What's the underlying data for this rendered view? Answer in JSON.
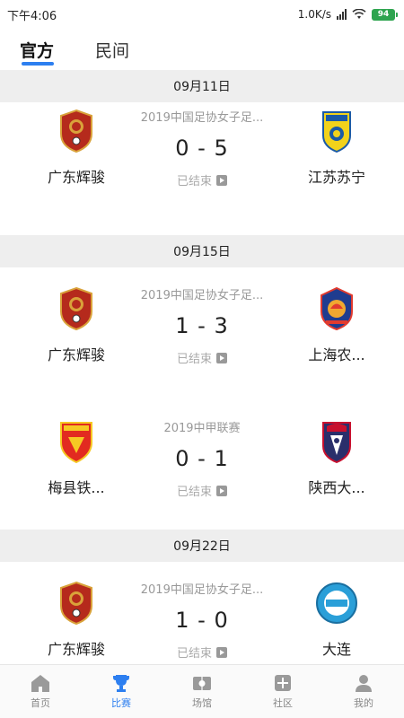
{
  "status_bar": {
    "time": "下午4:06",
    "speed": "1.0K/s",
    "battery": "94"
  },
  "top_tabs": [
    {
      "label": "官方",
      "active": true
    },
    {
      "label": "民间",
      "active": false
    }
  ],
  "sections": [
    {
      "date": "09月11日",
      "matches": [
        {
          "home": "广东辉骏",
          "away": "江苏苏宁",
          "league": "2019中国足协女子足...",
          "score": "0 - 5",
          "status": "已结束"
        }
      ]
    },
    {
      "date": "09月15日",
      "matches": [
        {
          "home": "广东辉骏",
          "away": "上海农...",
          "league": "2019中国足协女子足...",
          "score": "1 - 3",
          "status": "已结束"
        },
        {
          "home": "梅县铁...",
          "away": "陕西大...",
          "league": "2019中甲联赛",
          "score": "0 - 1",
          "status": "已结束"
        }
      ]
    },
    {
      "date": "09月22日",
      "matches": [
        {
          "home": "广东辉骏",
          "away": "大连",
          "league": "2019中国足协女子足...",
          "score": "1 - 0",
          "status": "已结束"
        }
      ]
    }
  ],
  "bottom_nav": [
    {
      "label": "首页",
      "icon": "home-icon",
      "active": false
    },
    {
      "label": "比赛",
      "icon": "trophy-icon",
      "active": true
    },
    {
      "label": "场馆",
      "icon": "stadium-icon",
      "active": false
    },
    {
      "label": "社区",
      "icon": "community-icon",
      "active": false
    },
    {
      "label": "我的",
      "icon": "profile-icon",
      "active": false
    }
  ],
  "colors": {
    "accent": "#2d7ff0",
    "header_bg": "#eeeeee",
    "muted_text": "#999999"
  }
}
